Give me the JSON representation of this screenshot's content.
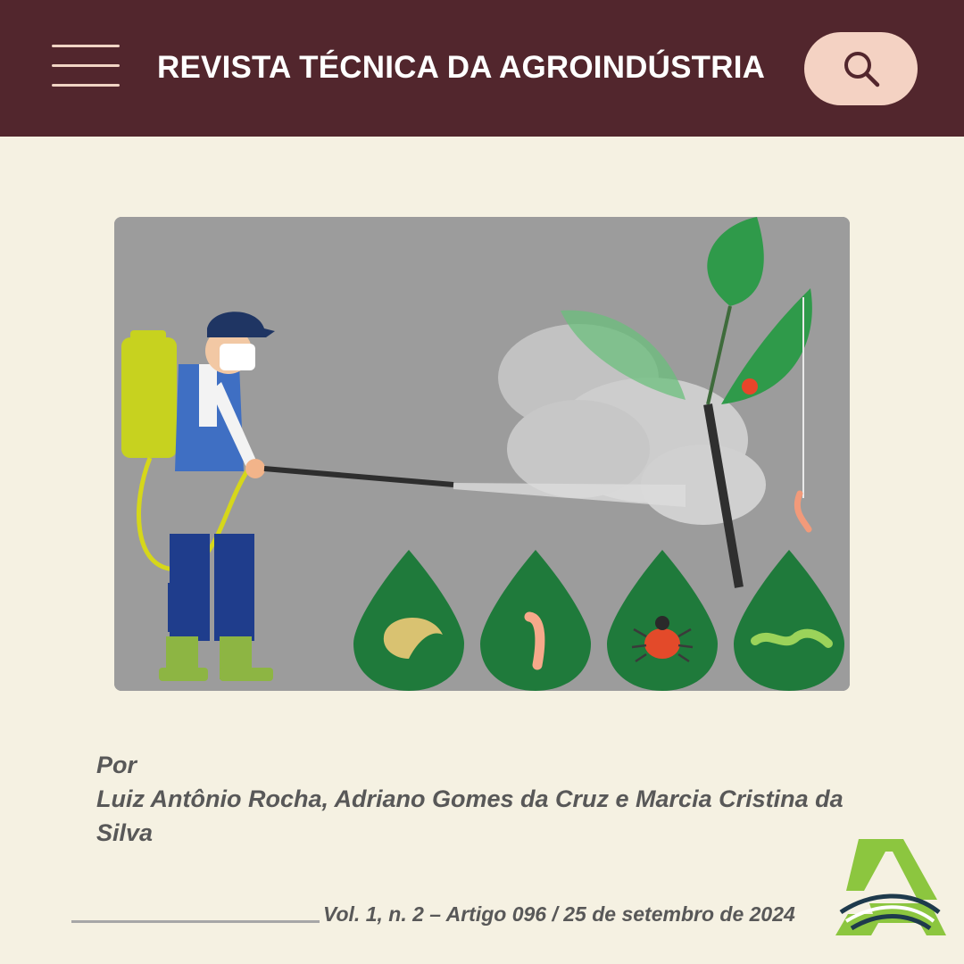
{
  "header": {
    "title": "REVISTA TÉCNICA DA AGROINDÚSTRIA",
    "menu_icon": "hamburger-menu-icon",
    "search_icon": "search-icon",
    "background_color": "#52262d",
    "search_button_color": "#f4d2c3"
  },
  "article": {
    "byline_prefix": "Por",
    "authors": "Luiz Antônio Rocha, Adriano Gomes da Cruz e Marcia Cristina da Silva",
    "meta": "Vol. 1, n. 2 – Artigo 096 / 25 de setembro de 2024"
  },
  "colors": {
    "page_background": "#f5f1e2",
    "text": "#585858",
    "logo_green": "#8cc63f",
    "logo_dark": "#1e3a4c"
  }
}
